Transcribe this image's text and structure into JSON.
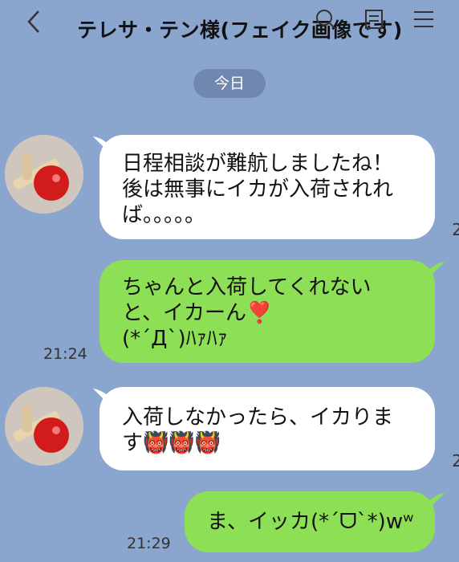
{
  "header": {
    "title": "テレサ・テン様(フェイク画像です)",
    "back_icon": "chevron-left-icon",
    "icons": [
      "search-icon",
      "document-icon",
      "menu-icon"
    ]
  },
  "date_label": "今日",
  "messages": [
    {
      "side": "in",
      "lines": [
        "日程相談が難航しましたね！",
        "後は無事にイカが入荷されれ",
        "ば。。。。。"
      ],
      "edge_num": "2"
    },
    {
      "side": "out",
      "lines": [
        "ちゃんと入荷してくれない",
        "と、イカーん❣️",
        "(*´Д`)ﾊｧﾊｧ"
      ],
      "time": "21:24"
    },
    {
      "side": "in",
      "lines": [
        "入荷しなかったら、イカりま",
        "す👹👹👹"
      ],
      "edge_num": "2"
    },
    {
      "side": "out",
      "lines": [
        "ま、イッカ(*´ᗜ`*)wʷ"
      ],
      "time": "21:29"
    }
  ],
  "colors": {
    "background": "#8aa6cf",
    "bubble_in": "#ffffff",
    "bubble_out": "#8de055",
    "date_pill": "#7088b0"
  }
}
